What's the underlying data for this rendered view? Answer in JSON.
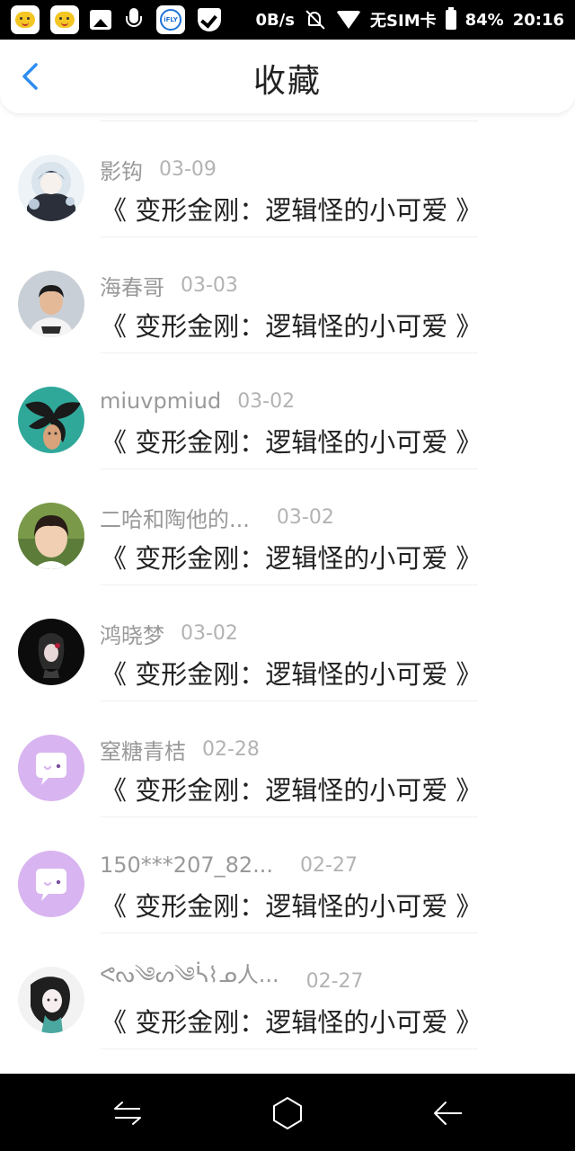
{
  "status_bar": {
    "net_speed": "0B/s",
    "sim": "无SIM卡",
    "battery": "84%",
    "time": "20:16",
    "icons": [
      "app-icon",
      "app-icon",
      "gallery-icon",
      "mic-icon",
      "ifly-icon",
      "shield-icon",
      "mute-icon",
      "wifi-icon",
      "battery-icon"
    ]
  },
  "header": {
    "title": "收藏",
    "back_icon": "chevron-left-icon"
  },
  "favorites": [
    {
      "user": "影钩",
      "date": "03-09",
      "title": "《 变形金刚：逻辑怪的小可爱 》",
      "avatar": "anime-girl"
    },
    {
      "user": "海春哥",
      "date": "03-03",
      "title": "《 变形金刚：逻辑怪的小可爱 》",
      "avatar": "boy-photo"
    },
    {
      "user": "miuvpmiud",
      "date": "03-02",
      "title": "《 变形金刚：逻辑怪的小可爱 》",
      "avatar": "black-bow"
    },
    {
      "user": "二哈和陶他的...",
      "date": "03-02",
      "title": "《 变形金刚：逻辑怪的小可爱 》",
      "avatar": "child-photo"
    },
    {
      "user": "鸿晓梦",
      "date": "03-02",
      "title": "《 变形金刚：逻辑怪的小可爱 》",
      "avatar": "dark-anime"
    },
    {
      "user": "窒糖青桔",
      "date": "02-28",
      "title": "《 变形金刚：逻辑怪的小可爱 》",
      "avatar": "default-chat"
    },
    {
      "user": "150***207_82...",
      "date": "02-27",
      "title": "《 变形金刚：逻辑怪的小可爱 》",
      "avatar": "default-chat"
    },
    {
      "user": "ᕙᔓ༄ᔕ༄ᓵ⌇ᓄ人...",
      "date": "02-27",
      "title": "《 变形金刚：逻辑怪的小可爱 》",
      "avatar": "anime-white"
    }
  ],
  "nav_bar": {
    "icons": [
      "switch-app-icon",
      "home-icon",
      "back-icon"
    ]
  },
  "colors": {
    "default_avatar": "#d8b4f0",
    "accent": "#2d8cf0"
  }
}
